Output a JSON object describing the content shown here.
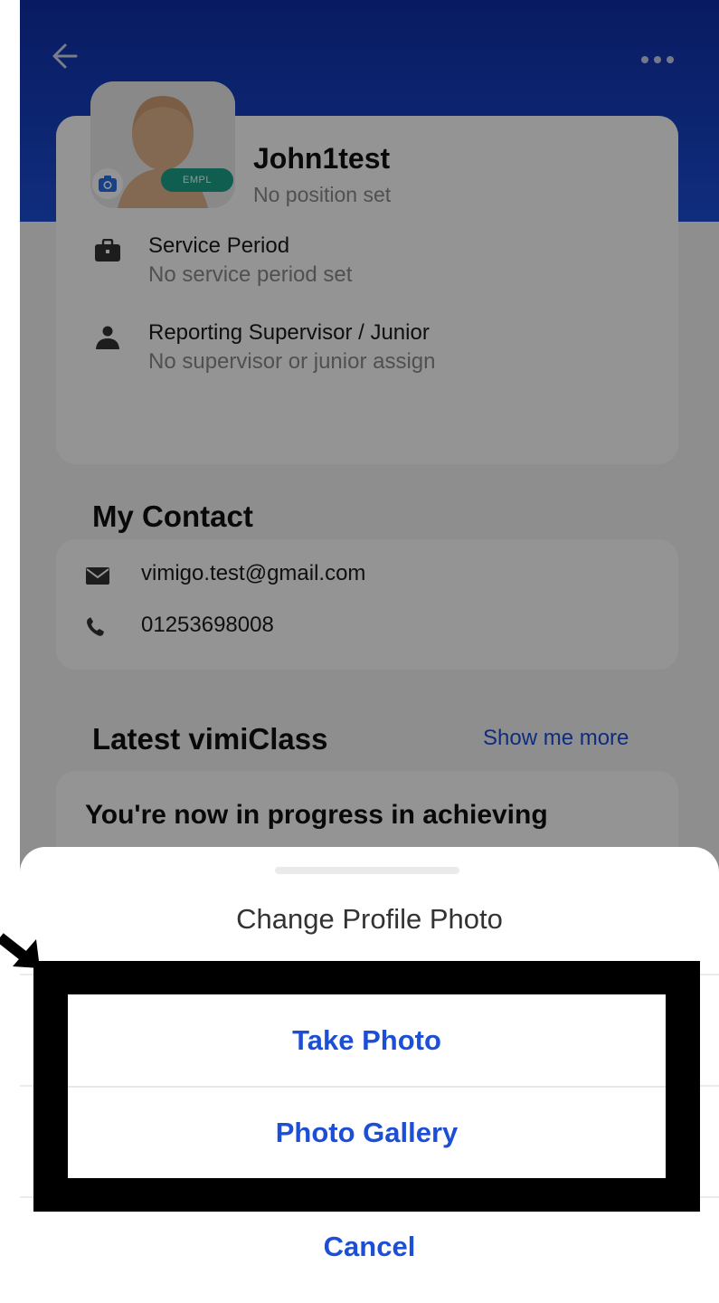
{
  "header": {
    "back_icon": "arrow-left-icon",
    "more_icon": "more-horizontal-icon",
    "bg_color": "#1c4fd8"
  },
  "profile": {
    "name": "John1test",
    "position": "No position set",
    "role_badge": "EMPL",
    "camera_icon": "camera-icon",
    "service": {
      "title": "Service Period",
      "value": "No service period set",
      "icon": "briefcase-icon"
    },
    "supervisor": {
      "title": "Reporting Supervisor / Junior",
      "value": "No supervisor or junior assign",
      "icon": "person-icon"
    }
  },
  "contact": {
    "section_title": "My Contact",
    "email": "vimigo.test@gmail.com",
    "email_icon": "mail-icon",
    "phone": "01253698008",
    "phone_icon": "phone-icon"
  },
  "vimiclass": {
    "section_title": "Latest vimiClass",
    "show_more": "Show me more",
    "card_text": "You're now in progress in achieving"
  },
  "sheet": {
    "title": "Change Profile Photo",
    "options": [
      {
        "label": "Take Photo"
      },
      {
        "label": "Photo Gallery"
      }
    ],
    "cancel": "Cancel",
    "accent_color": "#1d4fd6"
  },
  "annotation": {
    "arrow_icon": "pointer-arrow-icon",
    "highlight_color": "#000000"
  }
}
